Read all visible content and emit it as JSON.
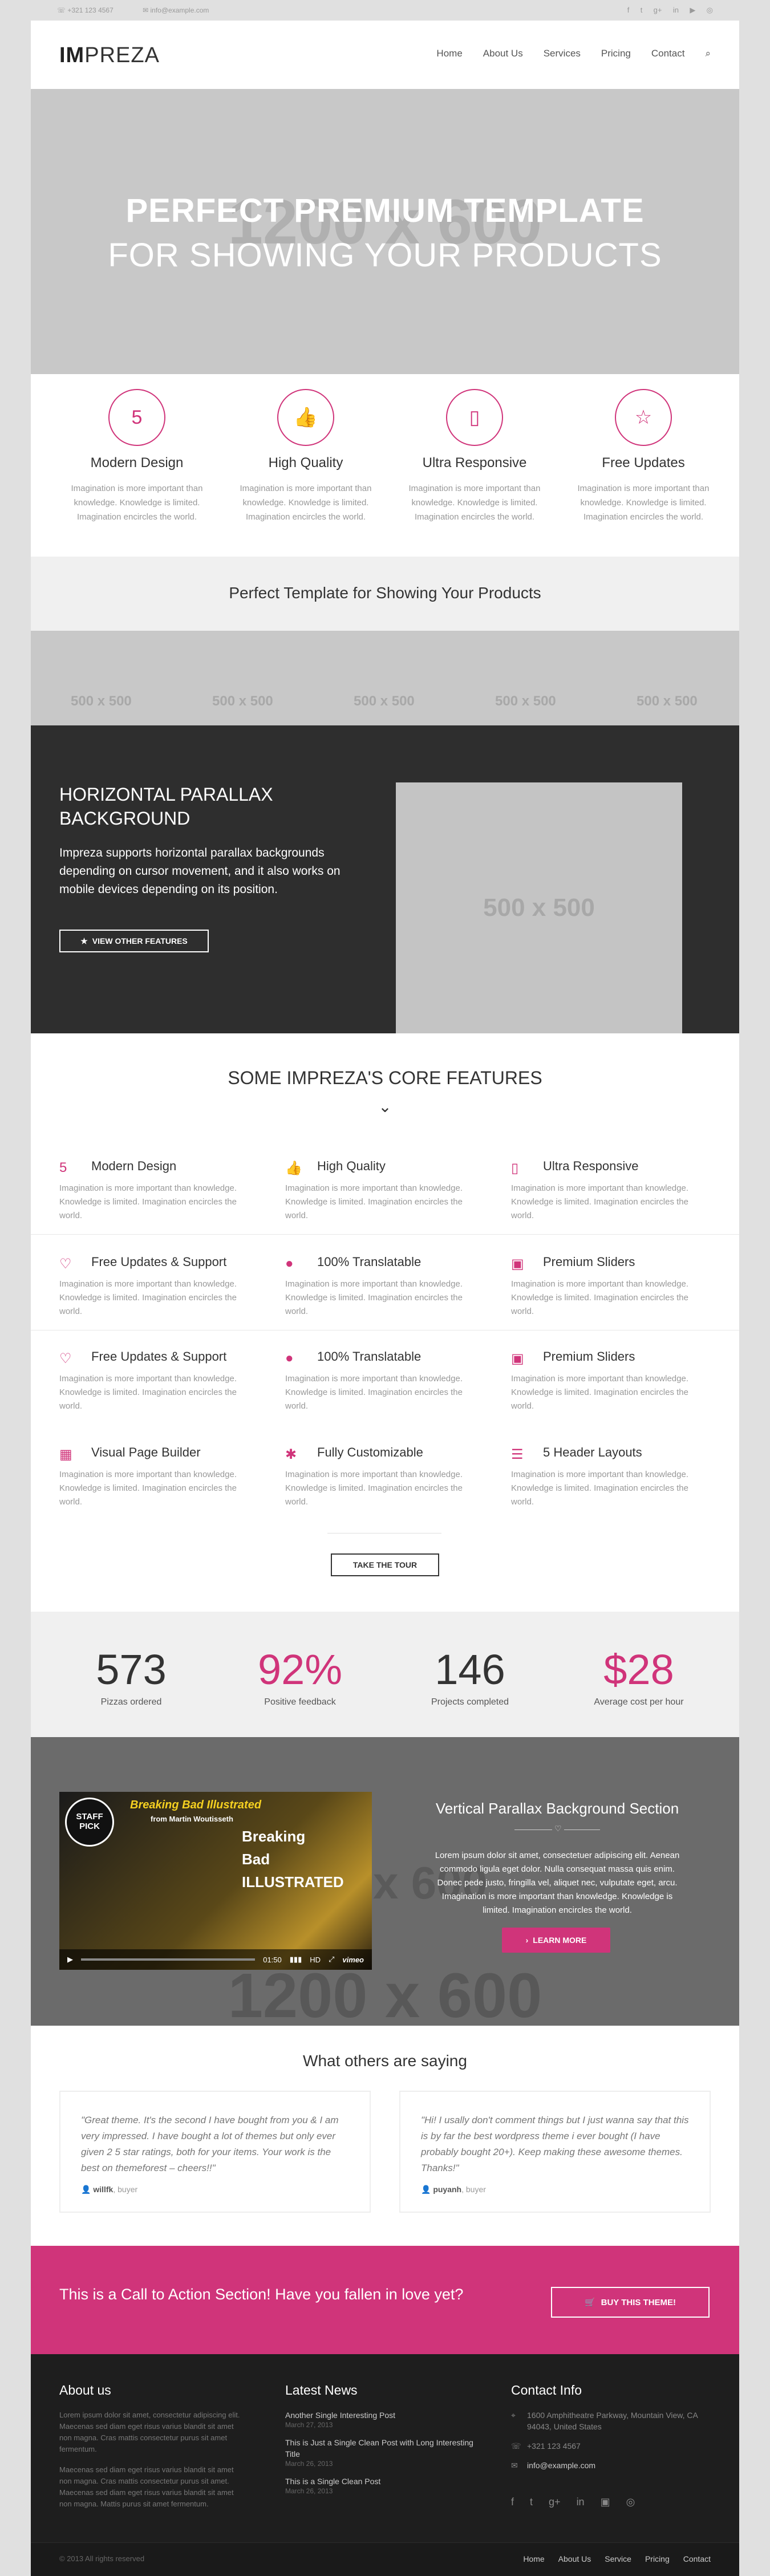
{
  "topbar": {
    "phone": "+321 123 4567",
    "email": "info@example.com",
    "social": [
      "f",
      "t",
      "g+",
      "in",
      "▶",
      "◎"
    ]
  },
  "header": {
    "logo_bold": "IM",
    "logo_rest": "PREZA",
    "nav": [
      "Home",
      "About Us",
      "Services",
      "Pricing",
      "Contact"
    ]
  },
  "hero": {
    "placeholder": "1200 x 600",
    "line1": "PERFECT PREMIUM TEMPLATE",
    "line2": "FOR SHOWING YOUR PRODUCTS"
  },
  "icons": [
    {
      "icon": "html5-icon",
      "glyph": "5",
      "title": "Modern Design",
      "text": "Imagination is more important than knowledge. Knowledge is limited. Imagination encircles the world."
    },
    {
      "icon": "thumbs-up-icon",
      "glyph": "👍",
      "title": "High Quality",
      "text": "Imagination is more important than knowledge. Knowledge is limited. Imagination encircles the world."
    },
    {
      "icon": "mobile-icon",
      "glyph": "▯",
      "title": "Ultra Responsive",
      "text": "Imagination is more important than knowledge. Knowledge is limited. Imagination encircles the world."
    },
    {
      "icon": "star-icon",
      "glyph": "☆",
      "title": "Free Updates",
      "text": "Imagination is more important than knowledge. Knowledge is limited. Imagination encircles the world."
    }
  ],
  "band": {
    "title": "Perfect Template for Showing Your Products"
  },
  "thumbs": [
    "500 x 500",
    "500 x 500",
    "500 x 500",
    "500 x 500",
    "500 x 500"
  ],
  "parallax": {
    "title": "HORIZONTAL PARALLAX BACKGROUND",
    "text": "Impreza supports horizontal parallax backgrounds depending on cursor movement, and it also works on mobile devices depending on its position.",
    "button": "VIEW OTHER FEATURES",
    "image": "500 x 500"
  },
  "features": {
    "title": "SOME IMPREZA'S CORE FEATURES",
    "button": "TAKE THE TOUR",
    "items": [
      {
        "glyph": "5",
        "title": "Modern Design",
        "text": "Imagination is more important than knowledge. Knowledge is limited. Imagination encircles the world."
      },
      {
        "glyph": "👍",
        "title": "High Quality",
        "text": "Imagination is more important than knowledge. Knowledge is limited. Imagination encircles the world."
      },
      {
        "glyph": "▯",
        "title": "Ultra Responsive",
        "text": "Imagination is more important than knowledge. Knowledge is limited. Imagination encircles the world."
      },
      {
        "glyph": "♡",
        "title": "Free Updates & Support",
        "text": "Imagination is more important than knowledge. Knowledge is limited. Imagination encircles the world."
      },
      {
        "glyph": "●",
        "title": "100% Translatable",
        "text": "Imagination is more important than knowledge. Knowledge is limited. Imagination encircles the world."
      },
      {
        "glyph": "▣",
        "title": "Premium Sliders",
        "text": "Imagination is more important than knowledge. Knowledge is limited. Imagination encircles the world."
      },
      {
        "glyph": "♡",
        "title": "Free Updates & Support",
        "text": "Imagination is more important than knowledge. Knowledge is limited. Imagination encircles the world."
      },
      {
        "glyph": "●",
        "title": "100% Translatable",
        "text": "Imagination is more important than knowledge. Knowledge is limited. Imagination encircles the world."
      },
      {
        "glyph": "▣",
        "title": "Premium Sliders",
        "text": "Imagination is more important than knowledge. Knowledge is limited. Imagination encircles the world."
      },
      {
        "glyph": "▦",
        "title": "Visual Page Builder",
        "text": "Imagination is more important than knowledge. Knowledge is limited. Imagination encircles the world."
      },
      {
        "glyph": "✱",
        "title": "Fully Customizable",
        "text": "Imagination is more important than knowledge. Knowledge is limited. Imagination encircles the world."
      },
      {
        "glyph": "☰",
        "title": "5 Header Layouts",
        "text": "Imagination is more important than knowledge. Knowledge is limited. Imagination encircles the world."
      }
    ]
  },
  "stats": [
    {
      "value": "573",
      "label": "Pizzas ordered",
      "color": "#333333"
    },
    {
      "value": "92%",
      "label": "Positive feedback",
      "color": "#d0347a"
    },
    {
      "value": "146",
      "label": "Projects completed",
      "color": "#333333"
    },
    {
      "value": "$28",
      "label": "Average cost per hour",
      "color": "#d0347a"
    }
  ],
  "vsection": {
    "title": "Vertical Parallax Background Section",
    "text": "Lorem ipsum dolor sit amet, consectetuer adipiscing elit. Aenean commodo ligula eget dolor. Nulla consequat massa quis enim. Donec pede justo, fringilla vel, aliquet nec, vulputate eget, arcu. Imagination is more important than knowledge. Knowledge is limited. Imagination encircles the world.",
    "button": "LEARN MORE",
    "placeholder": "1200 x 600",
    "placeholder_side": "x 600",
    "video": {
      "badge": "STAFF PICK",
      "title": "Breaking Bad Illustrated",
      "by": "from Martin Woutisseth",
      "art": "Breaking Bad ILLUSTRATED",
      "time": "01:50",
      "hd": "HD",
      "brand": "vimeo"
    }
  },
  "testimonials": {
    "title": "What others are saying",
    "items": [
      {
        "quote": "\"Great theme. It's the second I have bought from you & I am very impressed. I have bought a lot of themes but only ever given 2 5 star ratings, both for your items. Your work is the best on themeforest – cheers!!\"",
        "author": "willfk",
        "role": "buyer"
      },
      {
        "quote": "\"Hi! I usally don't comment things but I just wanna say that this is by far the best wordpress theme i ever bought (I have probably bought 20+). Keep making these awesome themes. Thanks!\"",
        "author": "puyanh",
        "role": "buyer"
      }
    ]
  },
  "cta": {
    "text": "This is a Call to Action Section! Have you fallen in love yet?",
    "button": "BUY THIS THEME!"
  },
  "footer": {
    "about": {
      "title": "About us",
      "p1": "Lorem ipsum dolor sit amet, consectetur adipiscing elit. Maecenas sed diam eget risus varius blandit sit amet non magna. Cras mattis consectetur purus sit amet fermentum.",
      "p2": "Maecenas sed diam eget risus varius blandit sit amet non magna. Cras mattis consectetur purus sit amet. Maecenas sed diam eget risus varius blandit sit amet non magna. Mattis purus sit amet fermentum."
    },
    "news": {
      "title": "Latest News",
      "posts": [
        {
          "title": "Another Single Interesting Post",
          "date": "March 27, 2013"
        },
        {
          "title": "This is Just a Single Clean Post with Long Interesting Title",
          "date": "March 26, 2013"
        },
        {
          "title": "This is a Single Clean Post",
          "date": "March 26, 2013"
        }
      ]
    },
    "contact": {
      "title": "Contact Info",
      "address": "1600 Amphitheatre Parkway, Mountain View, CA 94043, United States",
      "phone": "+321 123 4567",
      "email": "info@example.com",
      "social": [
        "f",
        "t",
        "g+",
        "in",
        "▣",
        "◎"
      ]
    }
  },
  "bottom": {
    "copyright": "© 2013 All rights reserved",
    "nav": [
      "Home",
      "About Us",
      "Service",
      "Pricing",
      "Contact"
    ]
  }
}
